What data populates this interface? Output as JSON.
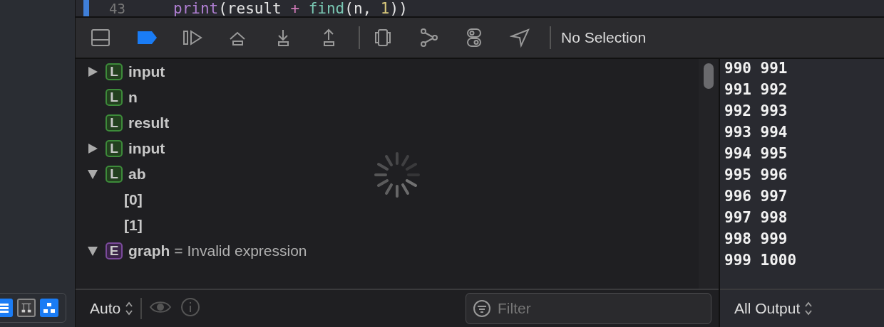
{
  "editor": {
    "line_number": "43",
    "breakpoint": true,
    "code": [
      {
        "kind": "function",
        "text": "print"
      },
      {
        "kind": "plain",
        "text": "(result "
      },
      {
        "kind": "operator",
        "text": "+ "
      },
      {
        "kind": "call",
        "text": "find"
      },
      {
        "kind": "plain",
        "text": "(n, "
      },
      {
        "kind": "number",
        "text": "1"
      },
      {
        "kind": "plain",
        "text": "))"
      }
    ]
  },
  "debug_bar": {
    "buttons": [
      {
        "kind": "toggle-area",
        "selected": false
      },
      {
        "kind": "breakpoints",
        "selected": true
      },
      {
        "kind": "continue",
        "selected": false
      },
      {
        "kind": "step-over",
        "selected": false
      },
      {
        "kind": "step-into",
        "selected": false
      },
      {
        "kind": "step-out",
        "selected": false
      },
      {
        "kind": "divider"
      },
      {
        "kind": "view-debugger",
        "selected": false
      },
      {
        "kind": "memory-graph",
        "selected": false
      },
      {
        "kind": "environment",
        "selected": false
      },
      {
        "kind": "location",
        "selected": false
      },
      {
        "kind": "divider"
      }
    ],
    "breadcrumb": "No Selection"
  },
  "variables": [
    {
      "kind": "local",
      "badge": "L",
      "name": "input",
      "expanded": false
    },
    {
      "kind": "local",
      "badge": "L",
      "name": "n"
    },
    {
      "kind": "local",
      "badge": "L",
      "name": "result"
    },
    {
      "kind": "local",
      "badge": "L",
      "name": "input",
      "expanded": false
    },
    {
      "kind": "local",
      "badge": "L",
      "name": "ab",
      "expanded": true,
      "children": [
        {
          "name": "[0]"
        },
        {
          "name": "[1]"
        }
      ]
    },
    {
      "kind": "expression",
      "badge": "E",
      "name": "graph",
      "value": "= Invalid expression",
      "expanded": true
    }
  ],
  "loading": true,
  "variables_footer": {
    "mode": "Auto",
    "filter": {
      "placeholder": "Filter"
    }
  },
  "output": {
    "lines": [
      "990 991",
      "991 992",
      "992 993",
      "993 994",
      "994 995",
      "995 996",
      "996 997",
      "997 998",
      "998 999",
      "999 1000"
    ],
    "selector": "All Output"
  },
  "navigator_buttons": [
    {
      "kind": "list",
      "selected": true
    },
    {
      "kind": "hierarchy",
      "selected": false
    },
    {
      "kind": "tree",
      "selected": true
    }
  ]
}
